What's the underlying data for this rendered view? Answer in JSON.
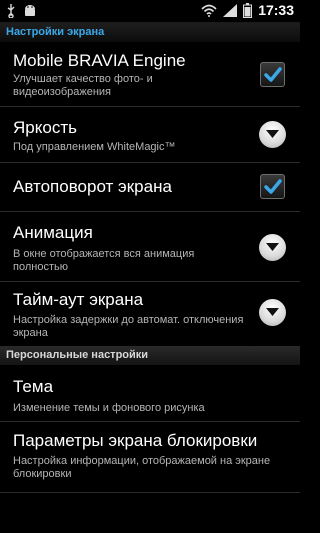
{
  "status_bar": {
    "time": "17:33",
    "icons": [
      "usb-icon",
      "android-debug-icon",
      "wifi-icon",
      "signal-icon",
      "battery-icon"
    ]
  },
  "accent_color": "#3aa8e8",
  "section_screen": {
    "header": "Настройки экрана"
  },
  "items": [
    {
      "title": "Mobile BRAVIA Engine",
      "summary": "Улучшает качество фото- и видеоизображения",
      "control": "checkbox",
      "checked": true
    },
    {
      "title": "Яркость",
      "summary": "Под управлением WhiteMagic™",
      "control": "dropdown"
    },
    {
      "title": "Автоповорот экрана",
      "summary": "",
      "control": "checkbox",
      "checked": true
    },
    {
      "title": "Анимация",
      "summary": "В окне отображается вся анимация полностью",
      "control": "dropdown"
    },
    {
      "title": "Тайм-аут экрана",
      "summary": "Настройка задержки до автомат. отключения экрана",
      "control": "dropdown"
    }
  ],
  "section_personal": {
    "header": "Персональные настройки"
  },
  "personal_items": [
    {
      "title": "Тема",
      "summary": "Изменение темы и фонового рисунка"
    },
    {
      "title": "Параметры экрана блокировки",
      "summary": "Настройка информации, отображаемой на экране блокировки"
    }
  ]
}
